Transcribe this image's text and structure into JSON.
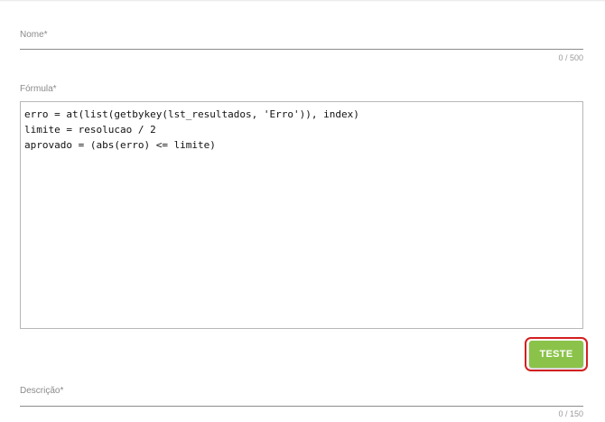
{
  "nome": {
    "label": "Nome*",
    "value": "",
    "counter": "0 / 500"
  },
  "formula": {
    "label": "Fórmula*",
    "lines": [
      "erro = at(list(getbykey(lst_resultados, 'Erro')), index)",
      "limite = resolucao / 2",
      "aprovado = (abs(erro) <= limite)"
    ]
  },
  "test_button": {
    "label": "TESTE",
    "color": "#8bc34a",
    "highlight_color": "#d32020"
  },
  "descricao": {
    "label": "Descrição*",
    "value": "",
    "counter": "0 / 150"
  }
}
